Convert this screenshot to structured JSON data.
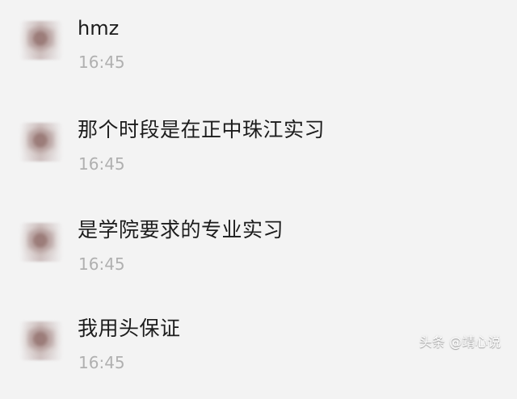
{
  "messages": [
    {
      "text": "hmz",
      "time": "16:45"
    },
    {
      "text": "那个时段是在正中珠江实习",
      "time": "16:45"
    },
    {
      "text": "是学院要求的专业实习",
      "time": "16:45"
    },
    {
      "text": "我用头保证",
      "time": "16:45"
    }
  ],
  "watermark": "头条 @靖心说"
}
